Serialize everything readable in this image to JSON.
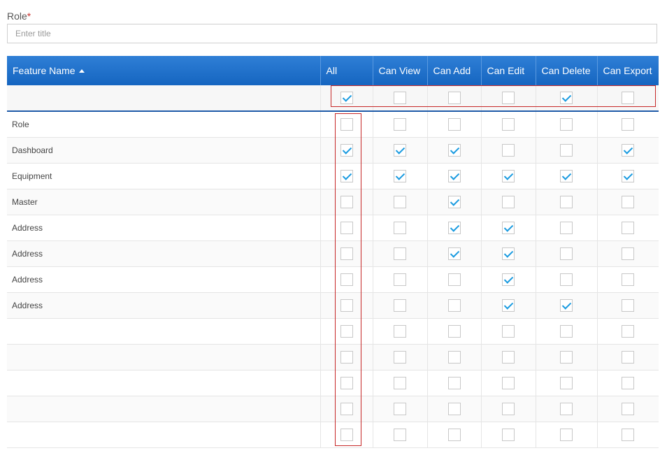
{
  "form": {
    "role_label": "Role",
    "required_mark": "*",
    "title_placeholder": "Enter title",
    "title_value": ""
  },
  "table": {
    "columns": [
      "Feature Name",
      "All",
      "Can View",
      "Can Add",
      "Can Edit",
      "Can Delete",
      "Can Export"
    ],
    "sort": {
      "column": "Feature Name",
      "direction": "ascending"
    },
    "select_all_row": [
      true,
      false,
      false,
      false,
      true,
      false
    ],
    "rows": [
      {
        "name": "Role",
        "checks": [
          false,
          false,
          false,
          false,
          false,
          false
        ]
      },
      {
        "name": "Dashboard",
        "checks": [
          true,
          true,
          true,
          false,
          false,
          true
        ]
      },
      {
        "name": "Equipment",
        "checks": [
          true,
          true,
          true,
          true,
          true,
          true
        ]
      },
      {
        "name": "Master",
        "checks": [
          false,
          false,
          true,
          false,
          false,
          false
        ]
      },
      {
        "name": "Address",
        "checks": [
          false,
          false,
          true,
          true,
          false,
          false
        ]
      },
      {
        "name": "Address",
        "checks": [
          false,
          false,
          true,
          true,
          false,
          false
        ]
      },
      {
        "name": "Address",
        "checks": [
          false,
          false,
          false,
          true,
          false,
          false
        ]
      },
      {
        "name": "Address",
        "checks": [
          false,
          false,
          false,
          true,
          true,
          false
        ]
      },
      {
        "name": "",
        "checks": [
          false,
          false,
          false,
          false,
          false,
          false
        ]
      },
      {
        "name": "",
        "checks": [
          false,
          false,
          false,
          false,
          false,
          false
        ]
      },
      {
        "name": "",
        "checks": [
          false,
          false,
          false,
          false,
          false,
          false
        ]
      },
      {
        "name": "",
        "checks": [
          false,
          false,
          false,
          false,
          false,
          false
        ]
      },
      {
        "name": "",
        "checks": [
          false,
          false,
          false,
          false,
          false,
          false
        ]
      }
    ]
  },
  "colors": {
    "header_blue": "#1565c0",
    "check_blue": "#1a9be0",
    "highlight_red": "#c62828",
    "required_red": "#c9302c"
  }
}
